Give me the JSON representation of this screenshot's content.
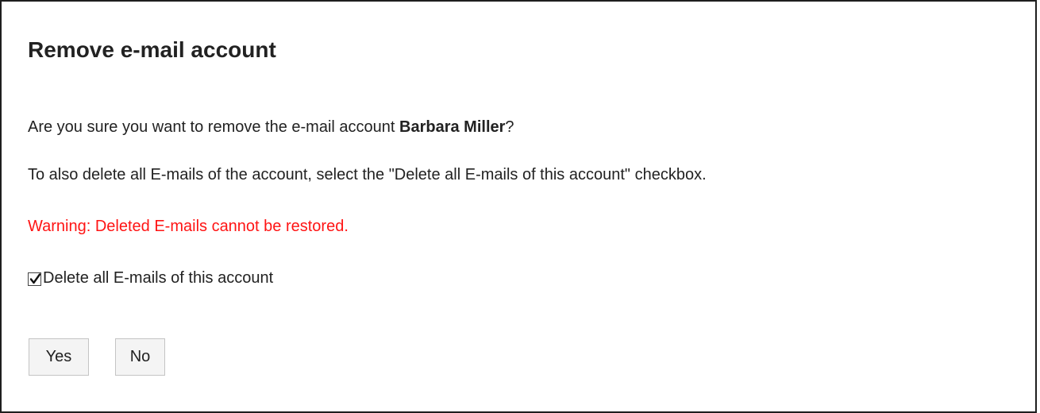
{
  "dialog": {
    "title": "Remove e-mail account",
    "confirm_prefix": "Are you sure you want to remove the e-mail account ",
    "account_name": "Barbara Miller",
    "confirm_suffix": "?",
    "instruction": "To also delete all E-mails of the account,  select the \"Delete all E-mails of this account\" checkbox.",
    "warning": "Warning: Deleted E-mails cannot be restored.",
    "checkbox_label": "Delete all E-mails of this account",
    "checkbox_checked": true,
    "yes_label": "Yes",
    "no_label": "No"
  },
  "colors": {
    "warning": "#ff1414",
    "border": "#1e1e1e",
    "button_bg": "#f4f4f4"
  }
}
